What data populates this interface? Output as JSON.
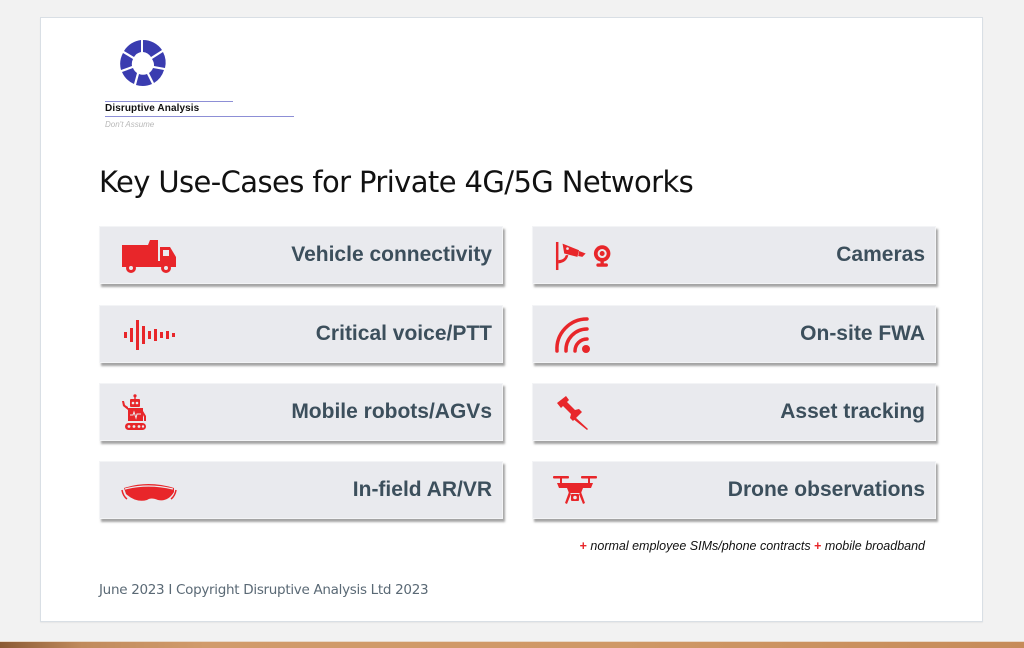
{
  "logo": {
    "name": "Disruptive Analysis",
    "tagline": "Don't Assume",
    "color": "#3a3cb0"
  },
  "title": "Key Use-Cases for Private 4G/5G Networks",
  "accent_color": "#e8262a",
  "use_cases": [
    {
      "label": "Vehicle connectivity",
      "icon": "truck-icon"
    },
    {
      "label": "Cameras",
      "icon": "camera-icon"
    },
    {
      "label": "Critical voice/PTT",
      "icon": "sound-wave-icon"
    },
    {
      "label": "On-site FWA",
      "icon": "wireless-signal-icon"
    },
    {
      "label": "Mobile robots/AGVs",
      "icon": "robot-icon"
    },
    {
      "label": "Asset tracking",
      "icon": "pushpin-icon"
    },
    {
      "label": "In-field AR/VR",
      "icon": "vr-headset-icon"
    },
    {
      "label": "Drone observations",
      "icon": "drone-icon"
    }
  ],
  "note": {
    "plus": "+",
    "item1": " normal employee SIMs/phone contracts ",
    "item2": " mobile broadband"
  },
  "footer": "June 2023  I  Copyright Disruptive Analysis Ltd 2023"
}
